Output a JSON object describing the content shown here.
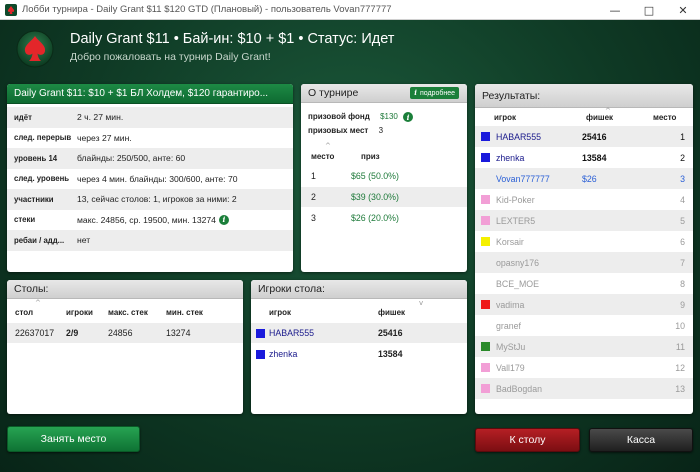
{
  "window": {
    "title": "Лобби турнира - Daily Grant $11 $120 GTD (Плановый) - пользователь Vovan777777"
  },
  "header": {
    "title": "Daily Grant $11 • Бай-ин: $10 + $1 • Статус: Идет",
    "subtitle": "Добро пожаловать на турнир Daily Grant!"
  },
  "info_panel": {
    "title": "Daily Grant $11: $10 + $1 БЛ Холдем, $120 гарантиро...",
    "rows": [
      {
        "k": "идёт",
        "v": "2 ч. 27 мин."
      },
      {
        "k": "след. перерыв",
        "v": "через 27 мин."
      },
      {
        "k": "уровень 14",
        "v": "блайнды: 250/500, анте: 60"
      },
      {
        "k": "след. уровень",
        "v": "через 4 мин. блайнды: 300/600, анте: 70"
      },
      {
        "k": "участники",
        "v": "13, сейчас столов: 1, игроков за ними: 2"
      },
      {
        "k": "стеки",
        "v": "макс. 24856, ср. 19500, мин. 13274"
      },
      {
        "k": "ребаи / адд...",
        "v": "нет"
      }
    ]
  },
  "about_panel": {
    "title": "О турнире",
    "details_label": "подробнее",
    "prize_pool_label": "призовой фонд",
    "prize_pool_value": "$130",
    "prize_places_label": "призовых мест",
    "prize_places_value": "3",
    "col_place": "место",
    "col_prize": "приз",
    "prizes": [
      {
        "place": "1",
        "prize": "$65 (50.0%)"
      },
      {
        "place": "2",
        "prize": "$39 (30.0%)"
      },
      {
        "place": "3",
        "prize": "$26 (20.0%)"
      }
    ]
  },
  "results_panel": {
    "title": "Результаты:",
    "col_player": "игрок",
    "col_chips": "фишек",
    "col_place": "место",
    "rows": [
      {
        "name": "HABAR555",
        "chips": "25416",
        "place": "1",
        "color": "#1a1adc",
        "style": "active"
      },
      {
        "name": "zhenka",
        "chips": "13584",
        "place": "2",
        "color": "#1a1adc",
        "style": "active"
      },
      {
        "name": "Vovan777777",
        "chips": "$26",
        "place": "3",
        "color": "",
        "style": "me"
      },
      {
        "name": "Kid-Poker",
        "chips": "",
        "place": "4",
        "color": "#f29fd6",
        "style": "out"
      },
      {
        "name": "LEXTER5",
        "chips": "",
        "place": "5",
        "color": "#f29fd6",
        "style": "out"
      },
      {
        "name": "Korsair",
        "chips": "",
        "place": "6",
        "color": "#f5f000",
        "style": "out"
      },
      {
        "name": "opasny176",
        "chips": "",
        "place": "7",
        "color": "",
        "style": "out"
      },
      {
        "name": "BCE_MOE",
        "chips": "",
        "place": "8",
        "color": "",
        "style": "out"
      },
      {
        "name": "vadima",
        "chips": "",
        "place": "9",
        "color": "#ee1a1a",
        "style": "out"
      },
      {
        "name": "granef",
        "chips": "",
        "place": "10",
        "color": "",
        "style": "out"
      },
      {
        "name": "MyStJu",
        "chips": "",
        "place": "11",
        "color": "#2a8a2a",
        "style": "out"
      },
      {
        "name": "Vall179",
        "chips": "",
        "place": "12",
        "color": "#f29fd6",
        "style": "out"
      },
      {
        "name": "BadBogdan",
        "chips": "",
        "place": "13",
        "color": "#f29fd6",
        "style": "out"
      }
    ]
  },
  "tables_panel": {
    "title": "Столы:",
    "col_table": "стол",
    "col_players": "игроки",
    "col_max": "макс. стек",
    "col_min": "мин. стек",
    "rows": [
      {
        "table": "22637017",
        "players": "2/9",
        "max": "24856",
        "min": "13274"
      }
    ]
  },
  "table_players_panel": {
    "title": "Игроки стола:",
    "col_player": "игрок",
    "col_chips": "фишек",
    "rows": [
      {
        "name": "HABAR555",
        "chips": "25416",
        "color": "#1a1adc"
      },
      {
        "name": "zhenka",
        "chips": "13584",
        "color": "#1a1adc"
      }
    ]
  },
  "buttons": {
    "take_seat": "Занять место",
    "to_table": "К столу",
    "cancel": "Касса"
  },
  "colors": {
    "felt": "#0f3a25",
    "accent_green": "#1b7f3a",
    "red_button": "#9b161b",
    "player_link": "#1a1a8c"
  }
}
